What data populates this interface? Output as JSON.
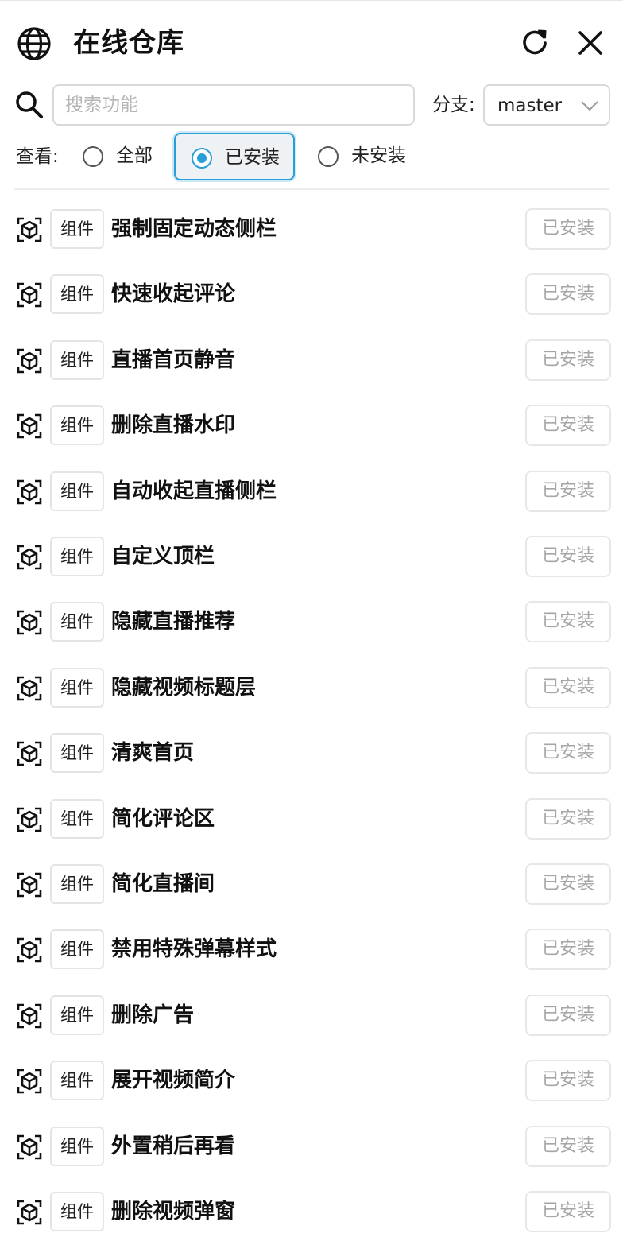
{
  "header": {
    "title": "在线仓库",
    "icon": "globe-icon",
    "actions": [
      "refresh-icon",
      "close-icon"
    ]
  },
  "search": {
    "placeholder": "搜索功能",
    "value": ""
  },
  "branch": {
    "label": "分支:",
    "selected": "master"
  },
  "filter": {
    "label": "查看:",
    "options": [
      {
        "label": "全部",
        "selected": false
      },
      {
        "label": "已安装",
        "selected": true
      },
      {
        "label": "未安装",
        "selected": false
      }
    ]
  },
  "colors": {
    "accent": "#2a9fd6",
    "muted_text": "#a6a6a6",
    "border": "#e4e4e4"
  },
  "items": [
    {
      "type": "组件",
      "name": "强制固定动态侧栏",
      "status": "已安装"
    },
    {
      "type": "组件",
      "name": "快速收起评论",
      "status": "已安装"
    },
    {
      "type": "组件",
      "name": "直播首页静音",
      "status": "已安装"
    },
    {
      "type": "组件",
      "name": "删除直播水印",
      "status": "已安装"
    },
    {
      "type": "组件",
      "name": "自动收起直播侧栏",
      "status": "已安装"
    },
    {
      "type": "组件",
      "name": "自定义顶栏",
      "status": "已安装"
    },
    {
      "type": "组件",
      "name": "隐藏直播推荐",
      "status": "已安装"
    },
    {
      "type": "组件",
      "name": "隐藏视频标题层",
      "status": "已安装"
    },
    {
      "type": "组件",
      "name": "清爽首页",
      "status": "已安装"
    },
    {
      "type": "组件",
      "name": "简化评论区",
      "status": "已安装"
    },
    {
      "type": "组件",
      "name": "简化直播间",
      "status": "已安装"
    },
    {
      "type": "组件",
      "name": "禁用特殊弹幕样式",
      "status": "已安装"
    },
    {
      "type": "组件",
      "name": "删除广告",
      "status": "已安装"
    },
    {
      "type": "组件",
      "name": "展开视频简介",
      "status": "已安装"
    },
    {
      "type": "组件",
      "name": "外置稍后再看",
      "status": "已安装"
    },
    {
      "type": "组件",
      "name": "删除视频弹窗",
      "status": "已安装"
    }
  ]
}
